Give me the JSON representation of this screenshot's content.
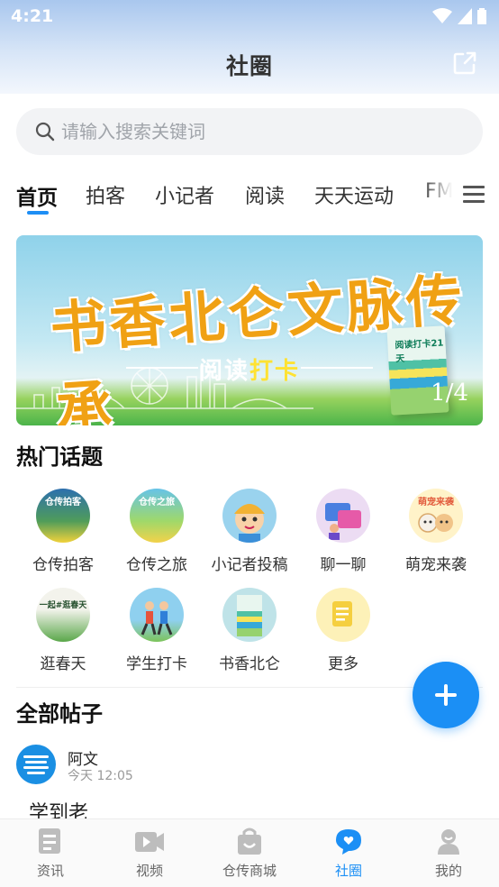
{
  "status": {
    "time": "4:21"
  },
  "header": {
    "title": "社圈"
  },
  "search": {
    "placeholder": "请输入搜索关键词"
  },
  "tabs": [
    {
      "label": "首页",
      "active": true
    },
    {
      "label": "拍客"
    },
    {
      "label": "小记者"
    },
    {
      "label": "阅读"
    },
    {
      "label": "天天运动"
    },
    {
      "label": "FM"
    }
  ],
  "banner": {
    "title": "书香北仑文脉传承",
    "subtitle_a": "阅读",
    "subtitle_b": "打卡",
    "book_title": "阅读打卡21天",
    "counter": "1/4"
  },
  "hot_topics": {
    "heading": "热门话题",
    "items": [
      {
        "label": "仓传拍客",
        "icon": "photo-icon",
        "caption": "仓传拍客"
      },
      {
        "label": "仓传之旅",
        "icon": "travel-icon",
        "caption": "仓传之旅"
      },
      {
        "label": "小记者投稿",
        "icon": "reporter-icon"
      },
      {
        "label": "聊一聊",
        "icon": "chat-icon"
      },
      {
        "label": "萌宠来袭",
        "icon": "pets-icon",
        "caption": "萌宠来袭"
      },
      {
        "label": "逛春天",
        "icon": "spring-icon",
        "caption": "一起#逛春天"
      },
      {
        "label": "学生打卡",
        "icon": "runner-icon"
      },
      {
        "label": "书香北仑",
        "icon": "books-icon"
      },
      {
        "label": "更多",
        "icon": "more-icon"
      }
    ]
  },
  "all_posts": {
    "heading": "全部帖子"
  },
  "post": {
    "author": "阿文",
    "time": "今天 12:05",
    "content": "学到老"
  },
  "bottom_nav": [
    {
      "label": "资讯",
      "icon": "news-icon"
    },
    {
      "label": "视频",
      "icon": "video-icon"
    },
    {
      "label": "仓传商城",
      "icon": "shop-icon"
    },
    {
      "label": "社圈",
      "icon": "community-icon",
      "active": true
    },
    {
      "label": "我的",
      "icon": "profile-icon"
    }
  ],
  "colors": {
    "accent": "#1b8ff5",
    "header_top": "#a9c7ee",
    "banner_orange": "#f0a114"
  }
}
